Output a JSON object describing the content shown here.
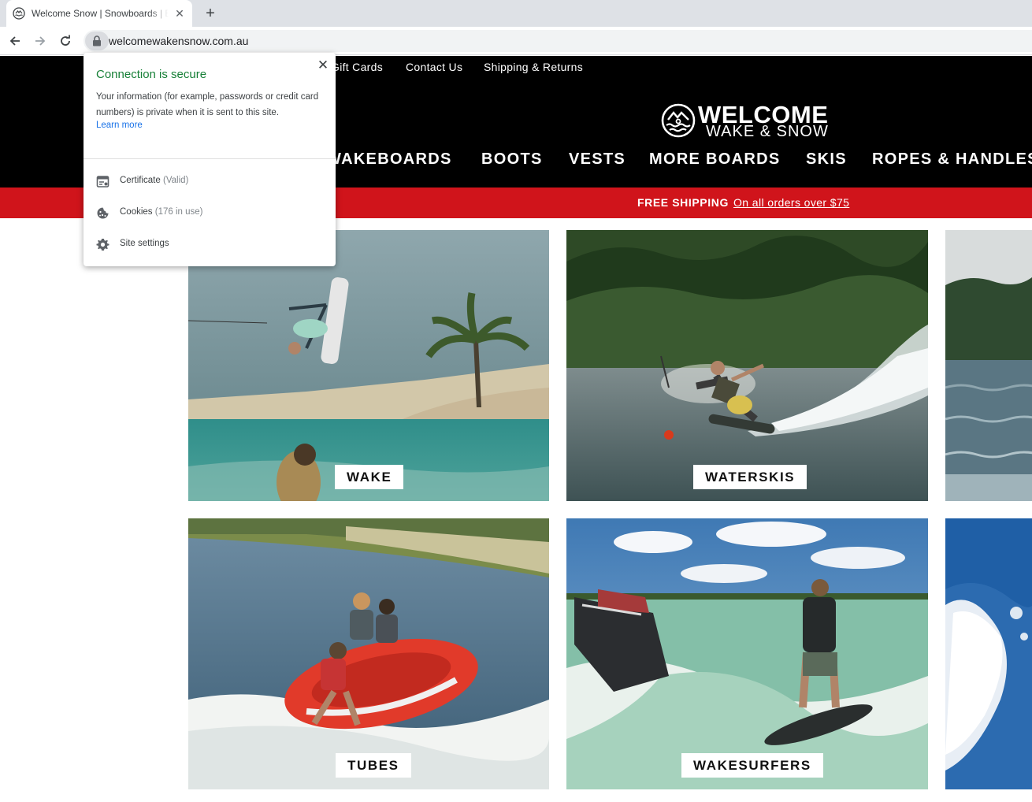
{
  "browser": {
    "tab_title": "Welcome Snow | Snowboards | Bindings",
    "tab_close": "✕",
    "new_tab": "+",
    "url": "welcomewakensnow.com.au"
  },
  "topnav": {
    "items": [
      "Gift Cards",
      "Contact Us",
      "Shipping & Returns"
    ]
  },
  "logo": {
    "line1": "WELCOME",
    "line2": "WAKE & SNOW"
  },
  "mainnav": {
    "items": [
      "WAKEBOARDS",
      "BOOTS",
      "VESTS",
      "MORE BOARDS",
      "SKIS",
      "ROPES & HANDLES"
    ]
  },
  "promo": {
    "bold": "FREE SHIPPING",
    "link": "On all orders over $75"
  },
  "tiles": [
    {
      "label": "WAKE"
    },
    {
      "label": "WATERSKIS"
    },
    {
      "label": "TUBES"
    },
    {
      "label": "WAKESURFERS"
    }
  ],
  "popup": {
    "title": "Connection is secure",
    "close": "✕",
    "description": "Your information (for example, passwords or credit card numbers) is private when it is sent to this site.",
    "learn_more": "Learn more",
    "rows": [
      {
        "label": "Certificate",
        "sub": "(Valid)",
        "icon": "certificate-icon"
      },
      {
        "label": "Cookies",
        "sub": "(176 in use)",
        "icon": "cookie-icon"
      },
      {
        "label": "Site settings",
        "sub": "",
        "icon": "gear-icon"
      }
    ]
  },
  "colors": {
    "promo": "#d0141b",
    "secure_green": "#188038",
    "link_blue": "#1a73e8"
  }
}
